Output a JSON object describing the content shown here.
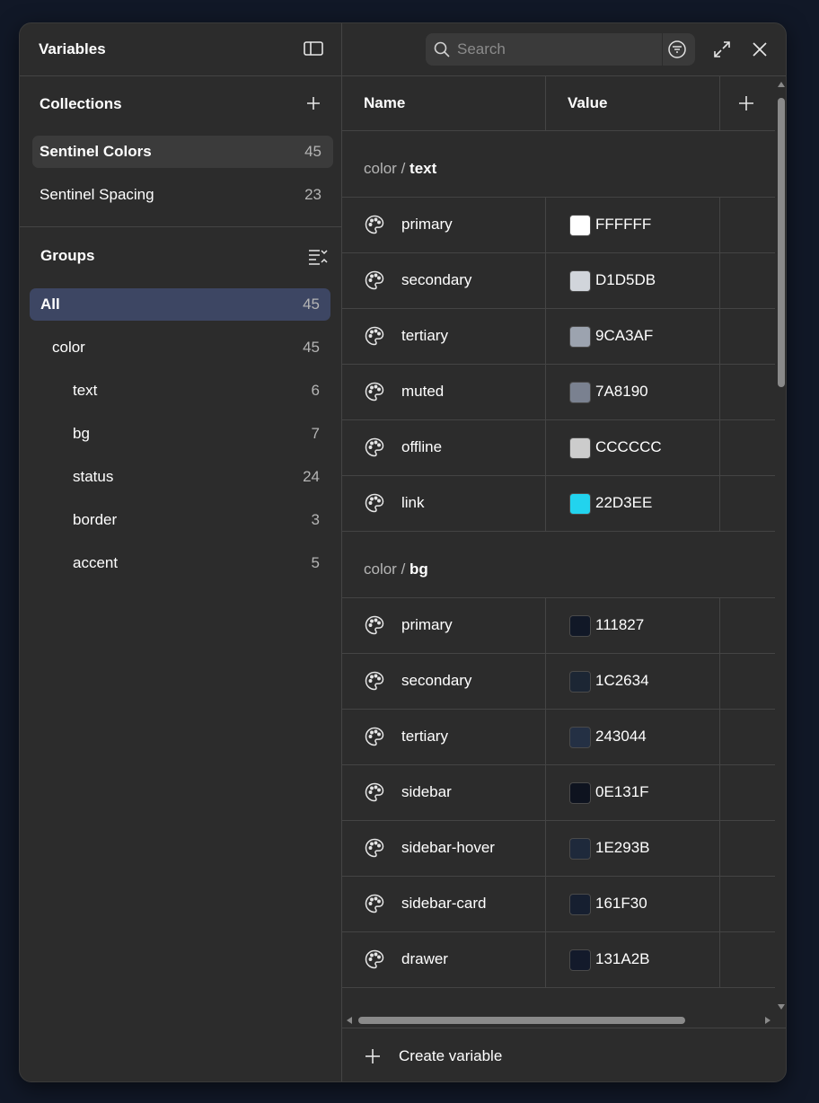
{
  "panel": {
    "title": "Variables"
  },
  "collections": {
    "title": "Collections",
    "items": [
      {
        "label": "Sentinel Colors",
        "count": "45",
        "selected": true
      },
      {
        "label": "Sentinel Spacing",
        "count": "23",
        "selected": false
      }
    ]
  },
  "groups": {
    "title": "Groups",
    "items": [
      {
        "label": "All",
        "count": "45",
        "selected": true
      },
      {
        "label": "color",
        "count": "45"
      },
      {
        "label": "text",
        "count": "6"
      },
      {
        "label": "bg",
        "count": "7"
      },
      {
        "label": "status",
        "count": "24"
      },
      {
        "label": "border",
        "count": "3"
      },
      {
        "label": "accent",
        "count": "5"
      }
    ]
  },
  "search": {
    "placeholder": "Search"
  },
  "table": {
    "columns": {
      "name": "Name",
      "value": "Value"
    },
    "groups": [
      {
        "prefix": "color / ",
        "name": "text",
        "rows": [
          {
            "name": "primary",
            "value": "FFFFFF",
            "color": "#FFFFFF"
          },
          {
            "name": "secondary",
            "value": "D1D5DB",
            "color": "#D1D5DB"
          },
          {
            "name": "tertiary",
            "value": "9CA3AF",
            "color": "#9CA3AF"
          },
          {
            "name": "muted",
            "value": "7A8190",
            "color": "#7A8190"
          },
          {
            "name": "offline",
            "value": "CCCCCC",
            "color": "#CCCCCC"
          },
          {
            "name": "link",
            "value": "22D3EE",
            "color": "#22D3EE"
          }
        ]
      },
      {
        "prefix": "color / ",
        "name": "bg",
        "rows": [
          {
            "name": "primary",
            "value": "111827",
            "color": "#111827"
          },
          {
            "name": "secondary",
            "value": "1C2634",
            "color": "#1C2634"
          },
          {
            "name": "tertiary",
            "value": "243044",
            "color": "#243044"
          },
          {
            "name": "sidebar",
            "value": "0E131F",
            "color": "#0E131F"
          },
          {
            "name": "sidebar-hover",
            "value": "1E293B",
            "color": "#1E293B"
          },
          {
            "name": "sidebar-card",
            "value": "161F30",
            "color": "#161F30"
          },
          {
            "name": "drawer",
            "value": "131A2B",
            "color": "#131A2B"
          }
        ]
      }
    ]
  },
  "footer": {
    "create_label": "Create variable"
  }
}
